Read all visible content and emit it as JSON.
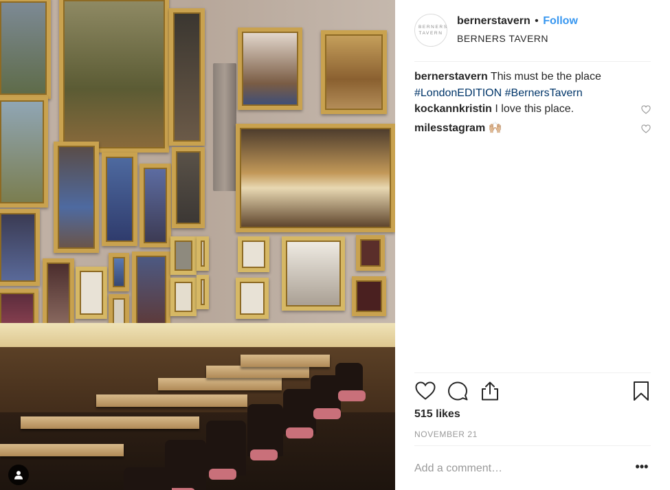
{
  "post": {
    "photo_label": "restaurant-photo"
  },
  "header": {
    "avatar_text": "BERNERS TAVERN",
    "username": "bernerstavern",
    "separator": "•",
    "follow_label": "Follow",
    "location": "BERNERS TAVERN"
  },
  "caption": {
    "user": "bernerstavern",
    "text": "This must be the place",
    "tag1": "#LondonEDITION",
    "tag2": "#BernersTavern"
  },
  "comments": [
    {
      "user": "kockannkristin",
      "text": "I love this place."
    },
    {
      "user": "milesstagram",
      "text": "🙌🏼"
    }
  ],
  "actions": {
    "like_icon": "heart-icon",
    "comment_icon": "comment-bubble-icon",
    "share_icon": "share-icon",
    "save_icon": "bookmark-icon"
  },
  "likes": "515 likes",
  "date": "NOVEMBER 21",
  "add_comment": {
    "placeholder": "Add a comment…",
    "more_label": "•••"
  },
  "colors": {
    "link": "#3897f0",
    "hashtag": "#003569",
    "muted": "#999999",
    "text": "#262626"
  }
}
